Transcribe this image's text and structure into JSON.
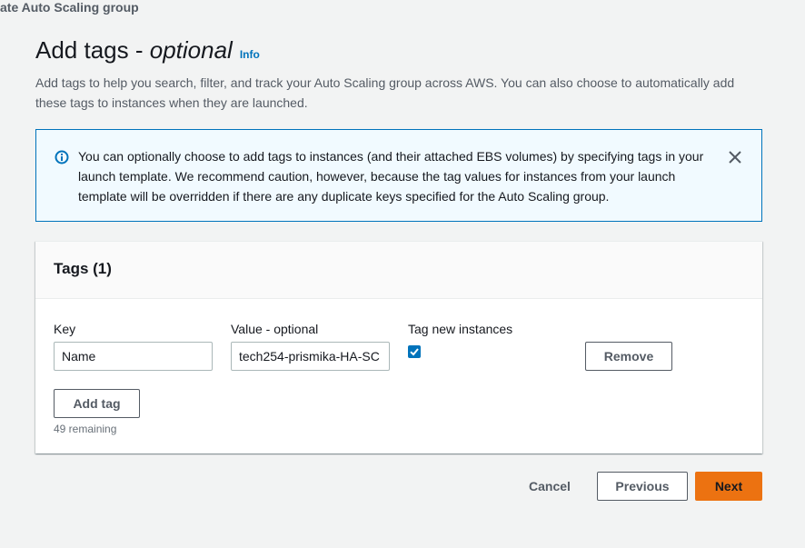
{
  "breadcrumb": "ate Auto Scaling group",
  "page": {
    "title_main": "Add tags - ",
    "title_optional": "optional",
    "info_label": "Info",
    "description": "Add tags to help you search, filter, and track your Auto Scaling group across AWS. You can also choose to automatically add these tags to instances when they are launched."
  },
  "alert": {
    "text": "You can optionally choose to add tags to instances (and their attached EBS volumes) by specifying tags in your launch template. We recommend caution, however, because the tag values for instances from your launch template will be overridden if there are any duplicate keys specified for the Auto Scaling group.",
    "icon": "info-circle-icon",
    "close_icon": "close-icon"
  },
  "tags_panel": {
    "title": "Tags (1)",
    "columns": {
      "key": "Key",
      "value": "Value - optional",
      "tag_new": "Tag new instances"
    },
    "rows": [
      {
        "key": "Name",
        "value": "tech254-prismika-HA-SC",
        "tag_new_instances": true
      }
    ],
    "remove_label": "Remove",
    "add_tag_label": "Add tag",
    "remaining": "49 remaining"
  },
  "footer": {
    "cancel": "Cancel",
    "previous": "Previous",
    "next": "Next"
  },
  "colors": {
    "primary": "#ec7211",
    "link": "#0073bb",
    "alert_bg": "#f1faff",
    "checkbox": "#0073bb"
  }
}
